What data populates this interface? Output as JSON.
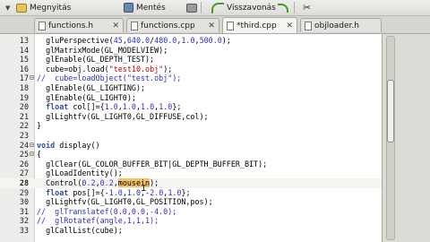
{
  "toolbar": {
    "open_label": "Megnyitás",
    "save_label": "Mentés",
    "undo_label": "Visszavonás"
  },
  "tabs": [
    {
      "label": "functions.h",
      "active": false
    },
    {
      "label": "functions.cpp",
      "active": false
    },
    {
      "label": "*third.cpp",
      "active": true
    },
    {
      "label": "objloader.h",
      "active": false
    }
  ],
  "code": [
    {
      "n": "13",
      "t": "  gluPerspective(45,640.0/480.0,1.0,500.0);"
    },
    {
      "n": "14",
      "t": "  glMatrixMode(GL_MODELVIEW);"
    },
    {
      "n": "15",
      "t": "  glEnable(GL_DEPTH_TEST);"
    },
    {
      "n": "16",
      "t": "  cube=obj.load(\"test10.obj\");"
    },
    {
      "n": "17",
      "t": "//  cube=loadObject(\"test.obj\");"
    },
    {
      "n": "18",
      "t": "  glEnable(GL_LIGHTING);"
    },
    {
      "n": "19",
      "t": "  glEnable(GL_LIGHT0);"
    },
    {
      "n": "20",
      "t": "  float col[]={1.0,1.0,1.0,1.0};"
    },
    {
      "n": "21",
      "t": "  glLightfv(GL_LIGHT0,GL_DIFFUSE,col);"
    },
    {
      "n": "22",
      "t": "}"
    },
    {
      "n": "23",
      "t": ""
    },
    {
      "n": "24",
      "t": "void display()"
    },
    {
      "n": "25",
      "t": "{"
    },
    {
      "n": "26",
      "t": "  glClear(GL_COLOR_BUFFER_BIT|GL_DEPTH_BUFFER_BIT);"
    },
    {
      "n": "27",
      "t": "  glLoadIdentity();"
    },
    {
      "n": "28",
      "t": "  Control(0.2,0.2,mousein);"
    },
    {
      "n": "29",
      "t": "  float pos[]={-1.0,1.0,-2.0,1.0};"
    },
    {
      "n": "30",
      "t": "  glLightfv(GL_LIGHT0,GL_POSITION,pos);"
    },
    {
      "n": "31",
      "t": "//  glTranslatef(0.0,0.0,-4.0);"
    },
    {
      "n": "32",
      "t": "//  glRotatef(angle,1,1,1);"
    },
    {
      "n": "33",
      "t": "  glCallList(cube);"
    }
  ]
}
